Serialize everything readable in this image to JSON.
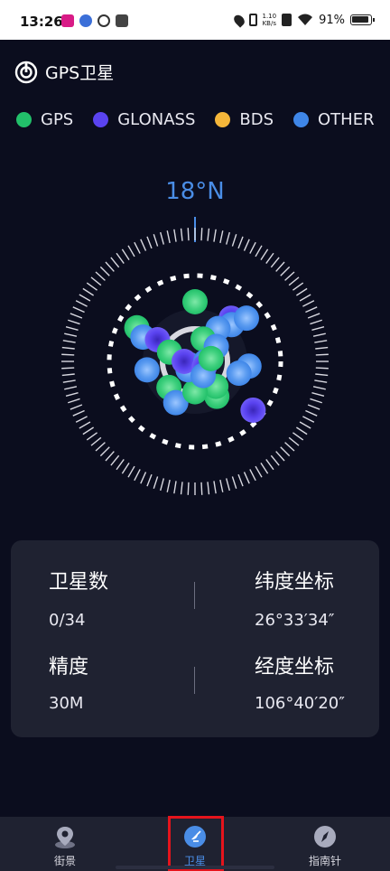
{
  "status_bar": {
    "time": "13:26",
    "net_speed_value": "1.10",
    "net_speed_unit": "KB/s",
    "battery": "91%"
  },
  "header": {
    "title": "GPS卫星",
    "icon": "gps-logo-icon"
  },
  "legend": [
    {
      "label": "GPS",
      "color": "#22c06a"
    },
    {
      "label": "GLONASS",
      "color": "#5a43f0"
    },
    {
      "label": "BDS",
      "color": "#f5b63a"
    },
    {
      "label": "OTHER",
      "color": "#3f86e8"
    }
  ],
  "compass": {
    "heading": "18°N",
    "accent_color": "#4a8de6"
  },
  "satellites": [
    {
      "type": "GPS",
      "az": 0,
      "r": 0.55
    },
    {
      "type": "GPS",
      "az": 300,
      "r": 0.62
    },
    {
      "type": "OTHER",
      "az": 295,
      "r": 0.53
    },
    {
      "type": "GLONASS",
      "az": 300,
      "r": 0.4
    },
    {
      "type": "GLONASS",
      "az": 40,
      "r": 0.52
    },
    {
      "type": "OTHER",
      "az": 45,
      "r": 0.48
    },
    {
      "type": "OTHER",
      "az": 50,
      "r": 0.62
    },
    {
      "type": "OTHER",
      "az": 35,
      "r": 0.37
    },
    {
      "type": "GPS",
      "az": 20,
      "r": 0.22
    },
    {
      "type": "OTHER",
      "az": 55,
      "r": 0.24
    },
    {
      "type": "GPS",
      "az": 290,
      "r": 0.25
    },
    {
      "type": "OTHER",
      "az": 260,
      "r": 0.45
    },
    {
      "type": "OTHER",
      "az": 95,
      "r": 0.5
    },
    {
      "type": "OTHER",
      "az": 105,
      "r": 0.42
    },
    {
      "type": "GLONASS",
      "az": 130,
      "r": 0.7
    },
    {
      "type": "GPS",
      "az": 148,
      "r": 0.38
    },
    {
      "type": "GPS",
      "az": 140,
      "r": 0.3
    },
    {
      "type": "GPS",
      "az": 225,
      "r": 0.34
    },
    {
      "type": "OTHER",
      "az": 205,
      "r": 0.42
    },
    {
      "type": "GPS",
      "az": 180,
      "r": 0.28
    },
    {
      "type": "OTHER",
      "az": 240,
      "r": 0.06
    },
    {
      "type": "OTHER",
      "az": 220,
      "r": 0.1
    },
    {
      "type": "GLONASS",
      "az": 270,
      "r": 0.1
    },
    {
      "type": "OTHER",
      "az": 90,
      "r": 0.1
    },
    {
      "type": "GLONASS",
      "az": 120,
      "r": 0.1
    },
    {
      "type": "OTHER",
      "az": 150,
      "r": 0.15
    },
    {
      "type": "GPS",
      "az": 80,
      "r": 0.15
    }
  ],
  "info": {
    "satellites_label": "卫星数",
    "satellites_value": "0/34",
    "latitude_label": "纬度坐标",
    "latitude_value": "26°33′34″",
    "accuracy_label": "精度",
    "accuracy_value": "30M",
    "longitude_label": "经度坐标",
    "longitude_value": "106°40′20″"
  },
  "nav": [
    {
      "label": "街景",
      "icon": "map-pin-icon"
    },
    {
      "label": "卫星",
      "icon": "satellite-dish-icon"
    },
    {
      "label": "指南针",
      "icon": "compass-icon"
    }
  ]
}
